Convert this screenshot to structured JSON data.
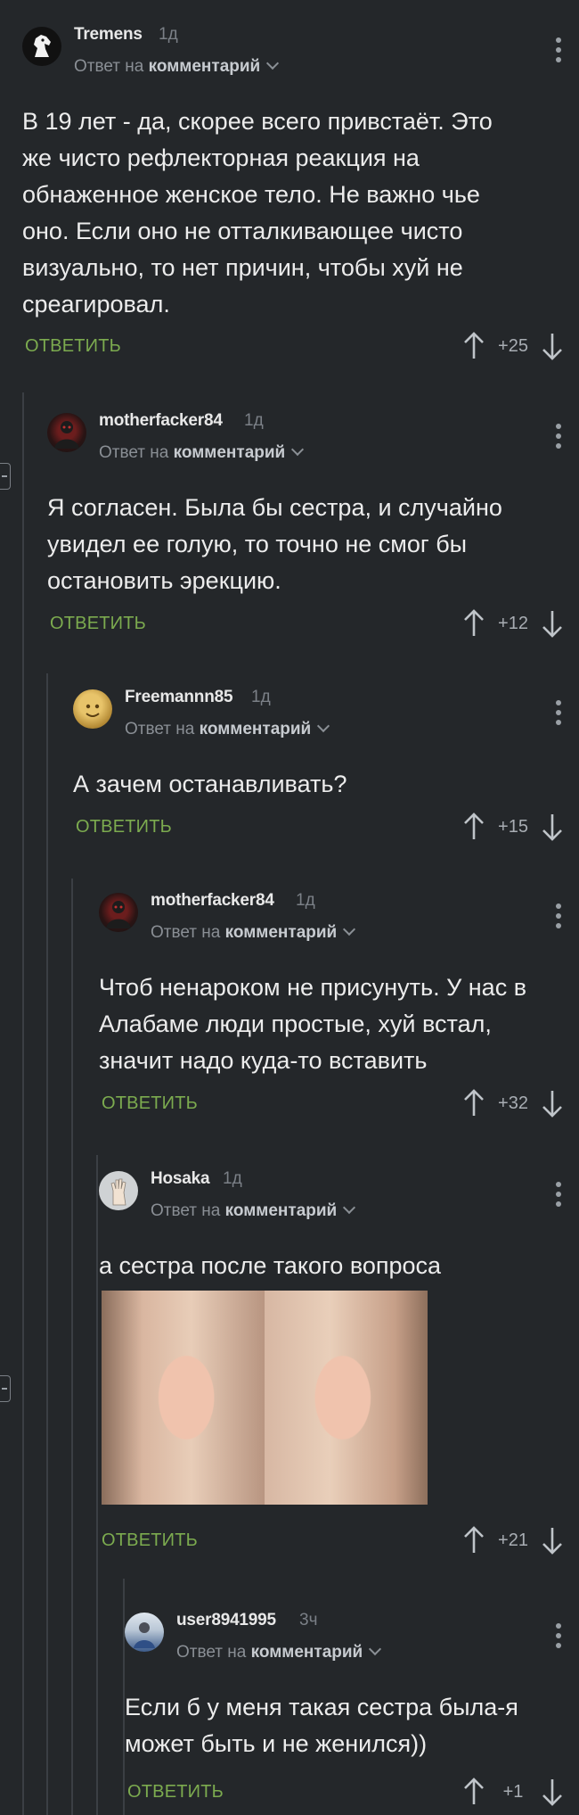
{
  "labels": {
    "reply_prefix": "Ответ на",
    "reply_target": "комментарий",
    "reply_button": "ОТВЕТИТЬ"
  },
  "colors": {
    "background": "#24272a",
    "reply_button": "#7cab4f",
    "thread_line": "#3b3f44"
  },
  "comments": [
    {
      "username": "Tremens",
      "time": "1д",
      "avatar_icon": "horse-head-icon",
      "text": "В 19 лет - да, скорее всего привстаёт. Это же чисто рефлекторная реакция на обнаженное женское тело. Не важно чье оно. Если оно не отталкивающее чисто визуально, то нет причин, чтобы хуй не среагировал.",
      "rating": "+25"
    },
    {
      "username": "motherfacker84",
      "time": "1д",
      "avatar_icon": "dark-figure-avatar-icon",
      "text": "Я согласен. Была бы сестра, и случайно увидел ее голую, то точно не смог бы остановить эрекцию.",
      "rating": "+12"
    },
    {
      "username": "Freemannn85",
      "time": "1д",
      "avatar_icon": "golden-face-avatar-icon",
      "text": "А зачем останавливать?",
      "rating": "+15"
    },
    {
      "username": "motherfacker84",
      "time": "1д",
      "avatar_icon": "dark-figure-avatar-icon",
      "text": "Чтоб ненароком не присунуть. У нас в Алабаме люди простые, хуй встал, значит надо куда-то вставить",
      "rating": "+32"
    },
    {
      "username": "Hosaka",
      "time": "1д",
      "avatar_icon": "hand-avatar-icon",
      "text": "а сестра после такого вопроса",
      "image_icon": "smiling-woman-photo",
      "rating": "+21"
    },
    {
      "username": "user8941995",
      "time": "3ч",
      "avatar_icon": "person-photo-avatar-icon",
      "text": "Если б у меня такая сестра была-я может быть и не женился))",
      "rating": "+1"
    }
  ]
}
